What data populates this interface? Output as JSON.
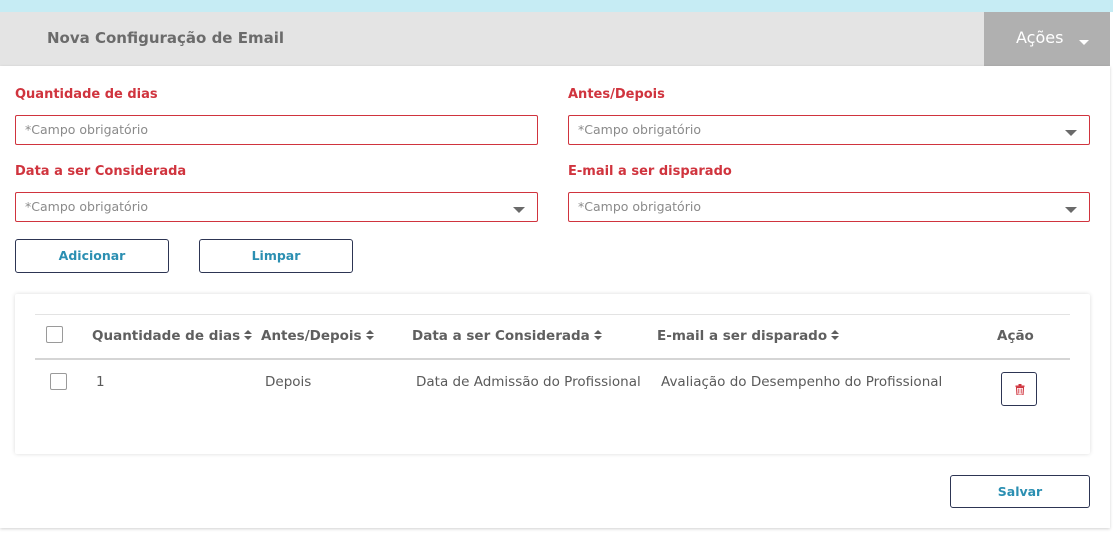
{
  "header": {
    "title": "Nova Configuração de Email",
    "actions_label": "Ações"
  },
  "form": {
    "quantidade_label": "Quantidade de dias",
    "quantidade_placeholder": "*Campo obrigatório",
    "antes_depois_label": "Antes/Depois",
    "antes_depois_placeholder": "*Campo obrigatório",
    "data_label": "Data a ser Considerada",
    "data_placeholder": "*Campo obrigatório",
    "email_label": "E-mail a ser disparado",
    "email_placeholder": "*Campo obrigatório",
    "add_label": "Adicionar",
    "clear_label": "Limpar"
  },
  "table": {
    "columns": [
      "Quantidade de dias",
      "Antes/Depois",
      "Data a ser Considerada",
      "E-mail a ser disparado",
      "Ação"
    ],
    "rows": [
      {
        "quantidade": "1",
        "antes_depois": "Depois",
        "data": "Data de Admissão do Profissional",
        "email": "Avaliação do Desempenho do Profissional"
      }
    ]
  },
  "footer": {
    "save_label": "Salvar"
  },
  "colors": {
    "accent_red": "#d0343e",
    "link_blue": "#2b8fb2",
    "header_gray": "#e4e4e4",
    "actions_gray": "#b0b0b0",
    "top_strip": "#c6ecf4"
  },
  "icons": {
    "actions_caret": "caret-down-icon",
    "select_caret": "chevron-down-icon",
    "sort": "sort-icon",
    "delete": "trash-icon"
  }
}
